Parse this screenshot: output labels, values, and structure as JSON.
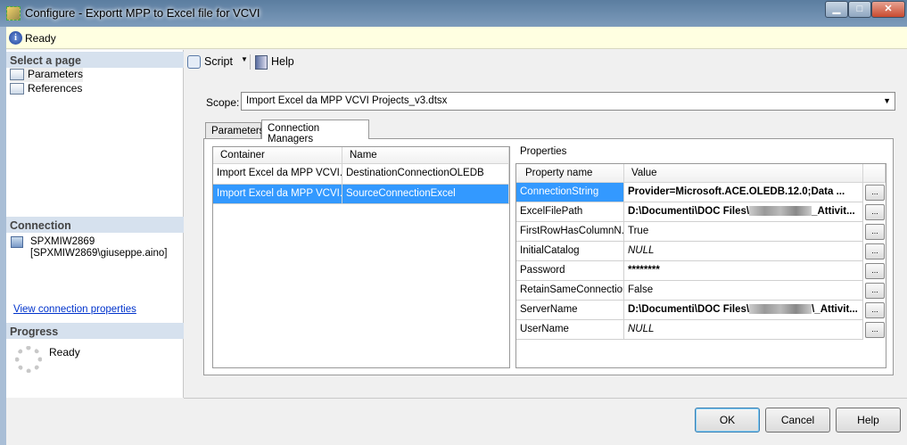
{
  "window": {
    "title": "Configure - Exportt MPP to Excel file for VCVI",
    "controls": [
      "minimize",
      "maximize",
      "close"
    ]
  },
  "infobar": {
    "status": "Ready"
  },
  "left": {
    "select_header": "Select a page",
    "pages": [
      {
        "label": "Parameters"
      },
      {
        "label": "References"
      }
    ],
    "connection_header": "Connection",
    "server": "SPXMIW2869",
    "user": "[SPXMIW2869\\giuseppe.aino]",
    "view_link": "View connection properties",
    "progress_header": "Progress",
    "progress_status": "Ready"
  },
  "toolbar": {
    "script": "Script",
    "help": "Help"
  },
  "scope": {
    "label": "Scope:",
    "value": "Import Excel da MPP VCVI Projects_v3.dtsx"
  },
  "tabs": [
    {
      "label": "Parameters"
    },
    {
      "label": "Connection Managers",
      "selected": true
    }
  ],
  "containers": {
    "headers": [
      "Container",
      "Name"
    ],
    "rows": [
      {
        "container": "Import Excel da MPP VCVI...",
        "name": "DestinationConnectionOLEDB"
      },
      {
        "container": "Import Excel da MPP VCVI...",
        "name": "SourceConnectionExcel",
        "selected": true
      }
    ]
  },
  "properties": {
    "label": "Properties",
    "headers": [
      "Property name",
      "Value"
    ],
    "rows": [
      {
        "name": "ConnectionString",
        "value": "Provider=Microsoft.ACE.OLEDB.12.0;Data ...",
        "style": "bold",
        "selected": true
      },
      {
        "name": "ExcelFilePath",
        "value_pre": "D:\\Documenti\\DOC Files\\",
        "value_post": "_Attivit...",
        "style": "bold"
      },
      {
        "name": "FirstRowHasColumnN...",
        "value": "True",
        "style": "normal"
      },
      {
        "name": "InitialCatalog",
        "value": "NULL",
        "style": "italic"
      },
      {
        "name": "Password",
        "value": "********",
        "style": "bold"
      },
      {
        "name": "RetainSameConnection",
        "value": "False",
        "style": "normal"
      },
      {
        "name": "ServerName",
        "value_pre": "D:\\Documenti\\DOC Files\\",
        "value_post": "\\_Attivit...",
        "style": "bold"
      },
      {
        "name": "UserName",
        "value": "NULL",
        "style": "italic"
      }
    ],
    "ellipsis": "..."
  },
  "buttons": {
    "ok": "OK",
    "cancel": "Cancel",
    "help": "Help"
  }
}
